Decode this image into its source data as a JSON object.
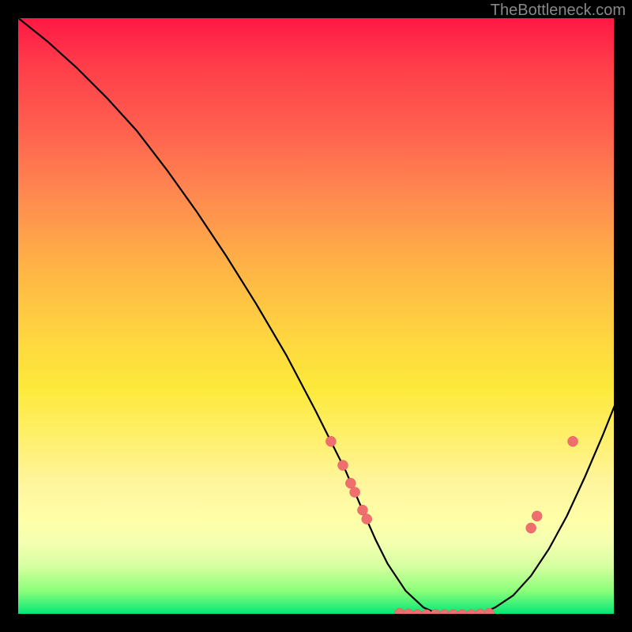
{
  "watermark": "TheBottleneck.com",
  "chart_data": {
    "type": "line",
    "title": "",
    "xlabel": "",
    "ylabel": "",
    "xlim": [
      0,
      100
    ],
    "ylim": [
      0,
      100
    ],
    "grid": false,
    "legend": false,
    "series": [
      {
        "name": "curve",
        "x": [
          0,
          5,
          10,
          15,
          20,
          25,
          30,
          35,
          40,
          45,
          50,
          52,
          55,
          58,
          60,
          62,
          65,
          68,
          70,
          72,
          75,
          78,
          80,
          83,
          86,
          89,
          92,
          95,
          98,
          100
        ],
        "y": [
          100,
          96,
          91.5,
          86.5,
          81,
          74.5,
          67.5,
          60,
          52,
          43.5,
          34,
          30,
          24,
          17,
          12.5,
          8.5,
          4,
          1.2,
          0.3,
          0,
          0,
          0.3,
          1.2,
          3.2,
          6.5,
          11,
          16.5,
          23,
          30,
          35
        ],
        "color": "#000000"
      }
    ],
    "markers": [
      {
        "x": 52.5,
        "y": 29
      },
      {
        "x": 54.5,
        "y": 25
      },
      {
        "x": 55.8,
        "y": 22
      },
      {
        "x": 56.5,
        "y": 20.5
      },
      {
        "x": 57.8,
        "y": 17.5
      },
      {
        "x": 58.5,
        "y": 16
      },
      {
        "x": 64,
        "y": 0.2
      },
      {
        "x": 65.5,
        "y": 0.1
      },
      {
        "x": 67,
        "y": 0
      },
      {
        "x": 68.5,
        "y": 0
      },
      {
        "x": 70,
        "y": 0
      },
      {
        "x": 71.5,
        "y": 0
      },
      {
        "x": 73,
        "y": 0
      },
      {
        "x": 74.5,
        "y": 0
      },
      {
        "x": 76,
        "y": 0
      },
      {
        "x": 77.5,
        "y": 0.1
      },
      {
        "x": 79,
        "y": 0.2
      },
      {
        "x": 86,
        "y": 14.5
      },
      {
        "x": 87,
        "y": 16.5
      },
      {
        "x": 93,
        "y": 29
      }
    ],
    "marker_color": "#ef6f6f"
  }
}
